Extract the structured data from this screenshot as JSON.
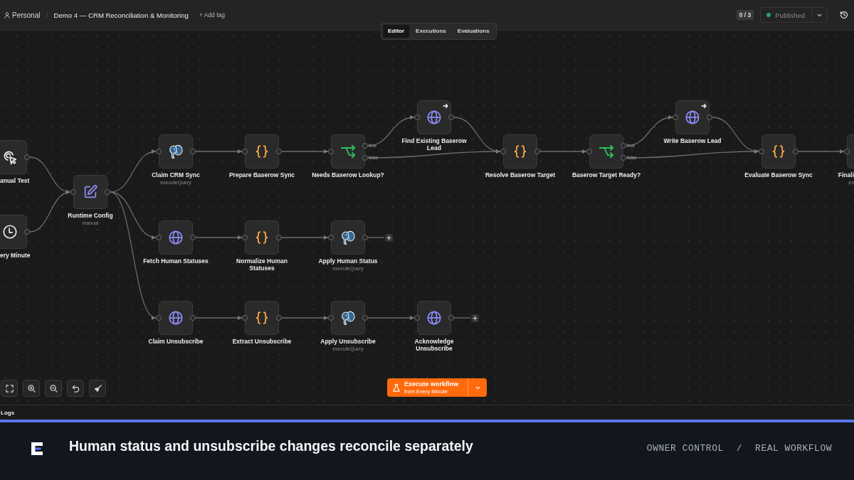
{
  "top_bar": {
    "project": "Personal",
    "separator": "/",
    "workflow_name": "Demo 4 — CRM Reconciliation & Monitoring",
    "add_tag": "+ Add tag",
    "counter": "0 / 3",
    "status": "Published"
  },
  "tabs": [
    {
      "label": "Editor",
      "selected": true
    },
    {
      "label": "Executions",
      "selected": false
    },
    {
      "label": "Evaluations",
      "selected": false
    }
  ],
  "canvas": {
    "nodes": [
      {
        "kind": "manual-trigger",
        "label": "anual Test",
        "arrow_marker": false,
        "add_button": false
      },
      {
        "kind": "schedule",
        "label": "ery Minute",
        "arrow_marker": false,
        "add_button": false
      },
      {
        "kind": "set",
        "label": "Runtime Config",
        "subtitle": "manual",
        "arrow_marker": false,
        "add_button": false
      },
      {
        "kind": "postgres",
        "label": "Claim CRM Sync",
        "subtitle": "executeQuery",
        "arrow_marker": false,
        "add_button": false
      },
      {
        "kind": "code",
        "label": "Prepare Baserow Sync",
        "arrow_marker": false,
        "add_button": false
      },
      {
        "kind": "if",
        "label": "Needs Baserow Lookup?",
        "outputs": [
          "true",
          "false"
        ],
        "arrow_marker": false,
        "add_button": false
      },
      {
        "kind": "http",
        "label": "Find Existing Baserow Lead",
        "arrow_marker": true,
        "add_button": false
      },
      {
        "kind": "code",
        "label": "Resolve Baserow Target",
        "arrow_marker": false,
        "add_button": false
      },
      {
        "kind": "if",
        "label": "Baserow Target Ready?",
        "outputs": [
          "true",
          "false"
        ],
        "arrow_marker": false,
        "add_button": false
      },
      {
        "kind": "http",
        "label": "Write Baserow Lead",
        "arrow_marker": true,
        "add_button": false
      },
      {
        "kind": "code",
        "label": "Evaluate Baserow Sync",
        "arrow_marker": false,
        "add_button": false
      },
      {
        "kind": "unknown",
        "label": "Finali",
        "subtitle": "ex",
        "arrow_marker": false,
        "add_button": false
      },
      {
        "kind": "http",
        "label": "Fetch Human Statuses",
        "arrow_marker": false,
        "add_button": false
      },
      {
        "kind": "code",
        "label": "Normalize Human Statuses",
        "arrow_marker": false,
        "add_button": false
      },
      {
        "kind": "postgres",
        "label": "Apply Human Status",
        "subtitle": "executeQuery",
        "arrow_marker": false,
        "add_button": true
      },
      {
        "kind": "http",
        "label": "Claim Unsubscribe",
        "arrow_marker": false,
        "add_button": false
      },
      {
        "kind": "code",
        "label": "Extract Unsubscribe",
        "arrow_marker": false,
        "add_button": false
      },
      {
        "kind": "postgres",
        "label": "Apply Unsubscribe",
        "subtitle": "executeQuery",
        "arrow_marker": false,
        "add_button": false
      },
      {
        "kind": "http",
        "label": "Acknowledge Unsubscribe",
        "arrow_marker": false,
        "add_button": true
      }
    ],
    "execute_button": {
      "label": "Execute workflow",
      "sublabel": "from Every Minute"
    }
  },
  "logs_panel": {
    "title": "Logs"
  },
  "footer": {
    "headline": "Human status and unsubscribe changes reconcile separately",
    "trail": [
      "OWNER CONTROL",
      "REAL WORKFLOW"
    ],
    "separator": "/"
  }
}
